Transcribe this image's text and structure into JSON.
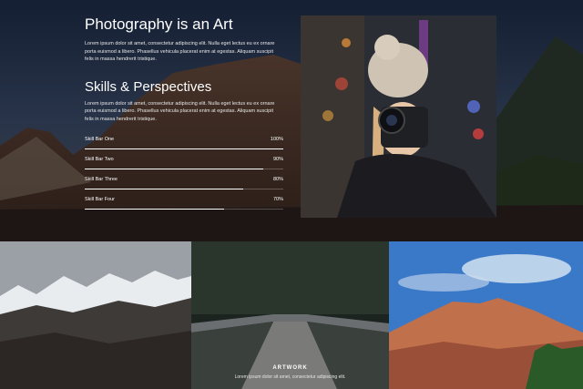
{
  "about": {
    "title": "Photography is an Art",
    "text": "Lorem ipsum dolor sit amet, consectetur adipiscing elit. Nulla eget lectus eu ex ornare porta euismod a libero. Phasellus vehicula placerat enim at egestas. Aliquam suscipit felis in massa hendrerit tristique."
  },
  "skills": {
    "title": "Skills & Perspectives",
    "text": "Lorem ipsum dolor sit amet, consectetur adipiscing elit. Nulla eget lectus eu ex ornare porta euismod a libero. Phasellus vehicula placerat enim at egestas. Aliquam suscipit felis in massa hendrerit tristique.",
    "bars": [
      {
        "label": "Skill Bar One",
        "value": 100,
        "value_label": "100%"
      },
      {
        "label": "Skill Bar Two",
        "value": 90,
        "value_label": "90%"
      },
      {
        "label": "Skill Bar Three",
        "value": 80,
        "value_label": "80%"
      },
      {
        "label": "Skill Bar Four",
        "value": 70,
        "value_label": "70%"
      }
    ]
  },
  "gallery": {
    "overlay_title": "ARTWORK",
    "overlay_text": "Lorem ipsum dolor sit amet, consectetur adipiscing elit."
  }
}
